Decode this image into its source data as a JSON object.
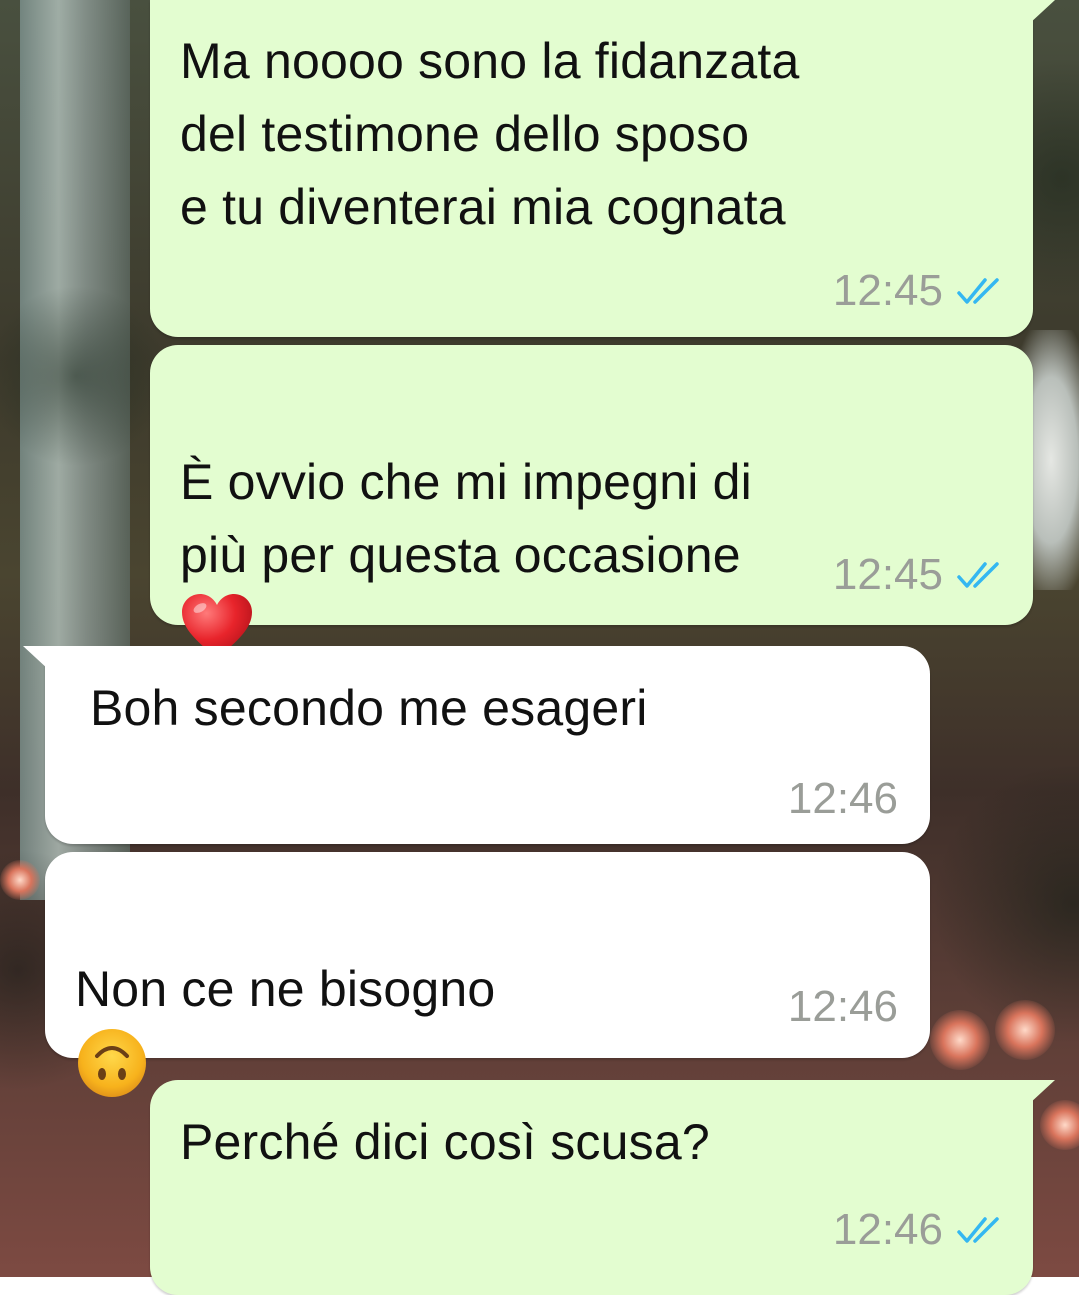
{
  "colors": {
    "outgoing_bubble": "#e3fdd0",
    "incoming_bubble": "#ffffff",
    "timestamp": "#9a9d98",
    "read_ticks": "#34b7f1",
    "message_text": "#111111"
  },
  "messages": [
    {
      "direction": "outgoing",
      "text": "Ma noooo sono la fidanzata\ndel testimone dello sposo\ne tu diventerai mia cognata",
      "time": "12:45",
      "status_icon": "read-receipt-icon"
    },
    {
      "direction": "outgoing",
      "text": "È ovvio che mi impegni di\npiù per questa occasione",
      "emoji": "red-heart-emoji",
      "time": "12:45",
      "status_icon": "read-receipt-icon"
    },
    {
      "direction": "incoming",
      "text": "Boh secondo me esageri",
      "time": "12:46"
    },
    {
      "direction": "incoming",
      "text": "Non ce ne bisogno",
      "emoji": "upside-down-face-emoji",
      "time": "12:46"
    },
    {
      "direction": "outgoing",
      "text": "Perché dici così scusa?",
      "time": "12:46",
      "status_icon": "read-receipt-icon"
    }
  ]
}
